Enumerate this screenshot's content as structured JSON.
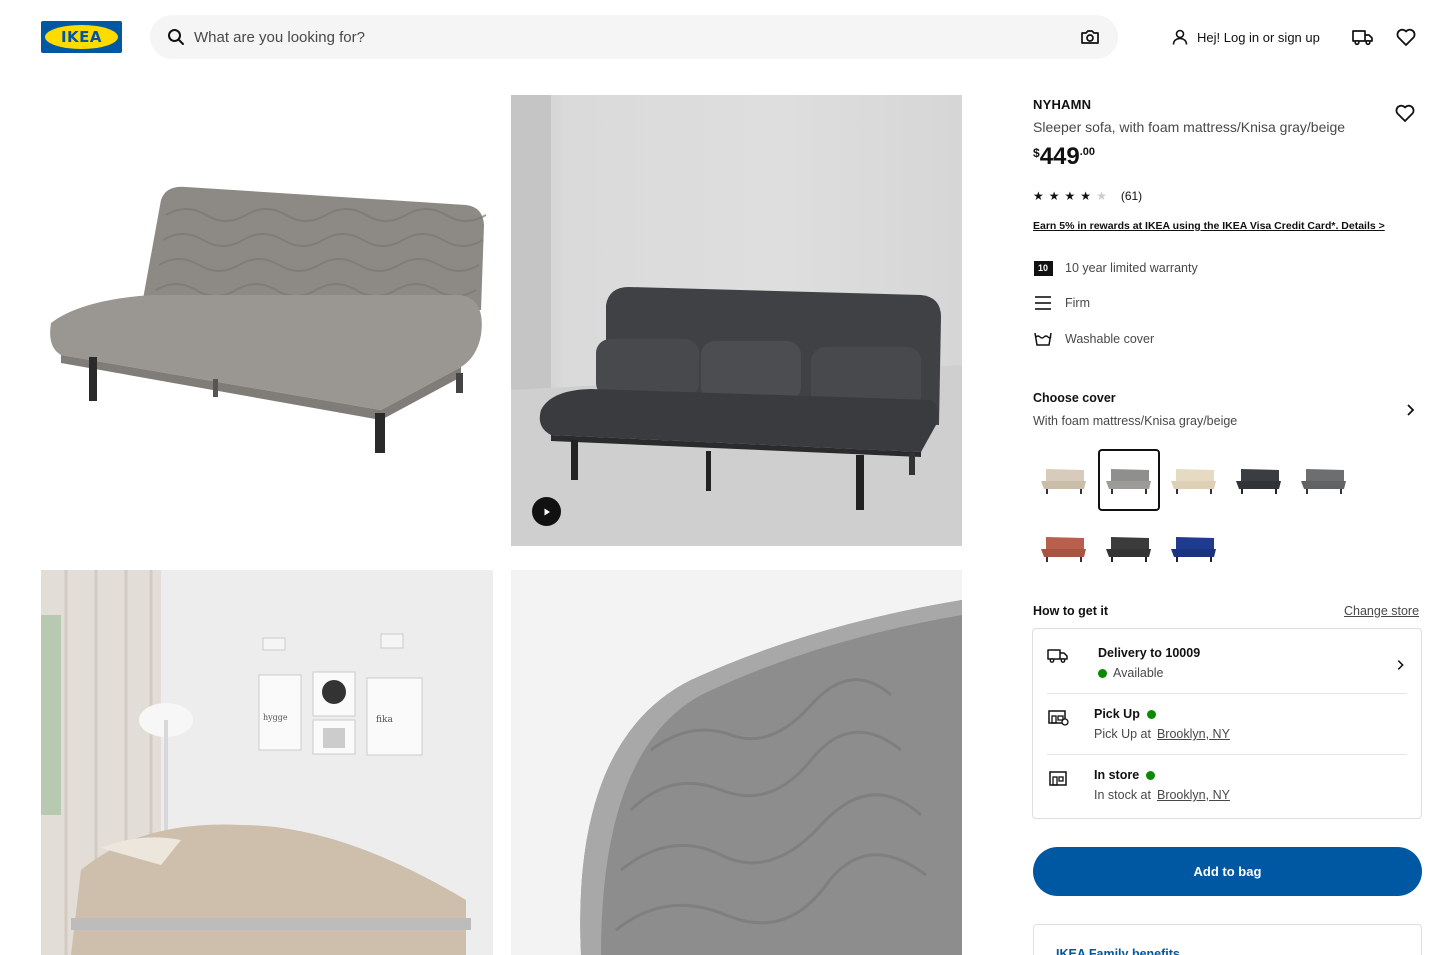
{
  "header": {
    "logo_text": "IKEA",
    "search_placeholder": "What are you looking for?",
    "login_label": "Hej! Log in or sign up"
  },
  "gallery": {
    "image_alts": [
      "NYHAMN sleeper sofa gray/beige",
      "NYHAMN sleeper sofa with cushions in room",
      "NYHAMN in bedroom setting",
      "Close-up of NYHAMN cover quilting"
    ],
    "video_label": "Play video",
    "wall_art_texts": [
      "hygge",
      "fika"
    ]
  },
  "product": {
    "name": "NYHAMN",
    "description": "Sleeper sofa, with foam mattress/Knisa gray/beige",
    "price": {
      "currency": "$",
      "integer": "449",
      "decimal": ".00"
    },
    "rating": {
      "stars": 4,
      "max": 5,
      "count": "(61)"
    },
    "promo": "Earn 5% in rewards at IKEA using the IKEA Visa Credit Card*. Details >",
    "features": [
      {
        "icon": "warranty-10-icon",
        "badge": "10",
        "label": "10 year limited warranty"
      },
      {
        "icon": "firmness-icon",
        "label": "Firm"
      },
      {
        "icon": "washable-cover-icon",
        "label": "Washable cover"
      }
    ]
  },
  "cover": {
    "title": "Choose cover",
    "selected": "With foam mattress/Knisa gray/beige",
    "swatches": [
      {
        "name": "beige",
        "color": "#d7cbbb"
      },
      {
        "name": "gray-beige",
        "color": "#8f8f8d",
        "selected": true
      },
      {
        "name": "light-beige",
        "color": "#e6dac2"
      },
      {
        "name": "dark-gray",
        "color": "#3a3d42"
      },
      {
        "name": "gray",
        "color": "#6c6e70"
      },
      {
        "name": "red-brown",
        "color": "#b8604d"
      },
      {
        "name": "anthracite",
        "color": "#3b3b3b"
      },
      {
        "name": "blue",
        "color": "#1f3b8f"
      }
    ]
  },
  "delivery": {
    "title": "How to get it",
    "change_store": "Change store",
    "rows": [
      {
        "title": "Delivery to 10009",
        "status": "Available"
      },
      {
        "title": "Pick Up",
        "line": "Pick Up at",
        "store": "Brooklyn, NY"
      },
      {
        "title": "In store",
        "line": "In stock at",
        "store": "Brooklyn, NY"
      }
    ],
    "status_color": "#0a8a00"
  },
  "actions": {
    "add_to_bag": "Add to bag",
    "family": "IKEA Family benefits"
  },
  "colors": {
    "brand_blue": "#0058a3",
    "brand_yellow": "#ffdb00"
  }
}
